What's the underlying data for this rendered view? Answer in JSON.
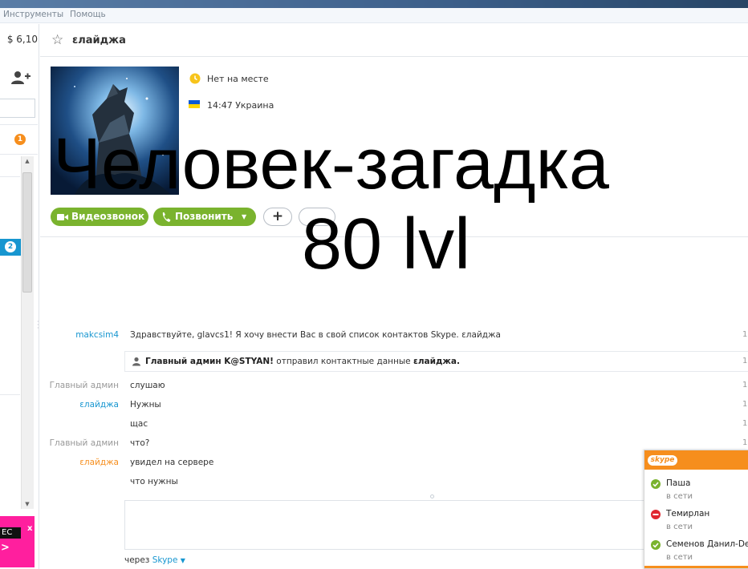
{
  "colors": {
    "accent_green": "#7ab32e",
    "skype_blue": "#1796d0",
    "notification_orange": "#f68e1d",
    "ad_pink": "#ff1f9e"
  },
  "menu": {
    "tools": "Инструменты",
    "help": "Помощь"
  },
  "sidebar": {
    "credit": "$ 6,10",
    "add_contact_icon": "add-contact-icon",
    "badge_top": "1",
    "badge_active": "2",
    "ad": {
      "label": "EC",
      "close": "x",
      "arrow": ">"
    }
  },
  "header": {
    "favorite_icon": "star-outline-icon",
    "contact_name": "εлайджа"
  },
  "profile": {
    "status": "Нет на месте",
    "local_time": "14:47 Украина",
    "video_call_label": "Видеозвонок",
    "call_label": "Позвонить",
    "add_label": "+"
  },
  "overlay": {
    "line1": "Человек-загадка",
    "line2": "80 lvl"
  },
  "chat": {
    "messages": [
      {
        "sender": "makcsim4",
        "text": "Здравствуйте, glavcs1! Я хочу внести Вас в свой список контактов Skype. εлайджа",
        "tick": "1"
      },
      {
        "sender": "Главный админ",
        "text": "слушаю",
        "tick": "1"
      },
      {
        "sender": "εлайджа",
        "text": "Нужны",
        "tick": "1"
      },
      {
        "sender": "",
        "text": "щас",
        "tick": "1"
      },
      {
        "sender": "Главный админ",
        "text": "что?",
        "tick": "1"
      },
      {
        "sender": "εлайджа",
        "text": "увидел на сервере",
        "tick": ""
      },
      {
        "sender": "",
        "text": "что нужны",
        "tick": ""
      }
    ],
    "system": {
      "actor": "Главный админ K@STYAN!",
      "action": " отправил контактные данные ",
      "object": "εлайджа.",
      "tick": "1"
    }
  },
  "compose": {
    "via_prefix": "через ",
    "via_service": "Skype"
  },
  "popup": {
    "logo": "skype",
    "contacts": [
      {
        "name": "Паша",
        "status": "в сети",
        "state": "online"
      },
      {
        "name": "Темирлан",
        "status": "в сети",
        "state": "busy"
      },
      {
        "name": "Семенов Данил-Denc",
        "status": "в сети",
        "state": "online"
      }
    ]
  }
}
